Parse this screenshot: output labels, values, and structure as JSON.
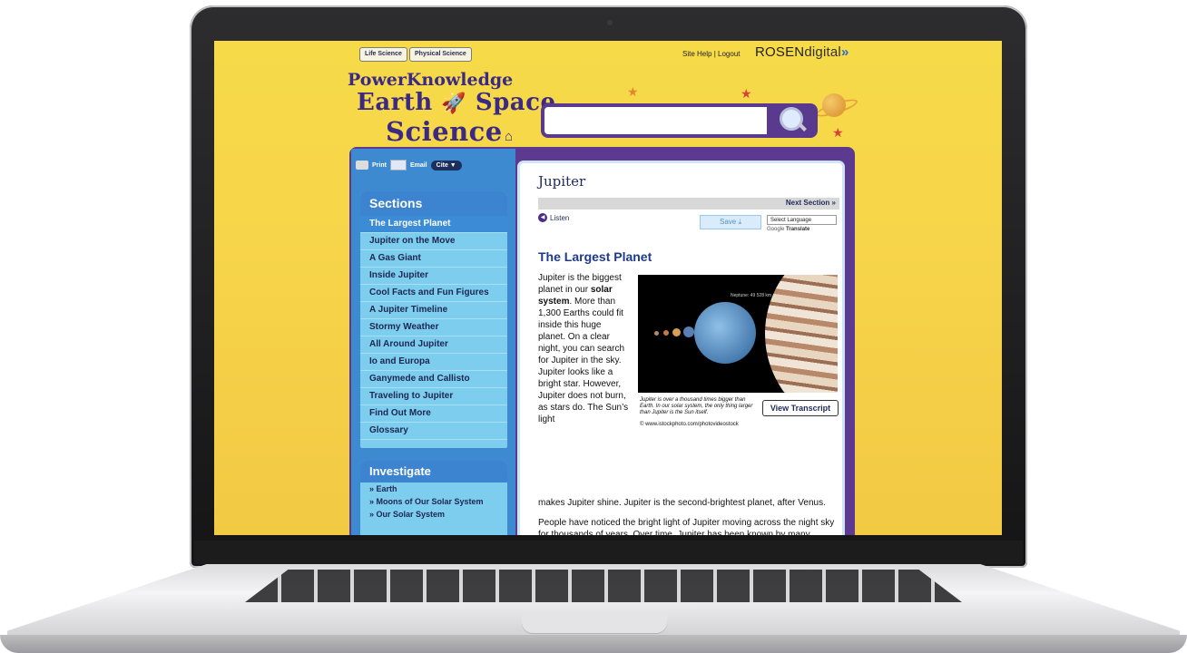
{
  "top_nav": {
    "life_science": "Life Science",
    "physical_science": "Physical Science",
    "site_help": "Site Help",
    "separator": "|",
    "logout": "Logout",
    "brand_rosen": "ROSEN",
    "brand_digital": "digital",
    "brand_chevrons": "»"
  },
  "logo": {
    "line1": "PowerKnowledge",
    "line2a": "Earth",
    "line2b": "Space",
    "line3": "Science"
  },
  "search": {
    "placeholder": ""
  },
  "toolbar": {
    "print": "Print",
    "email": "Email",
    "cite": "Cite ▼"
  },
  "sections": {
    "heading": "Sections",
    "items": [
      "The Largest Planet",
      "Jupiter on the Move",
      "A Gas Giant",
      "Inside Jupiter",
      "Cool Facts and Fun Figures",
      "A Jupiter Timeline",
      "Stormy Weather",
      "All Around Jupiter",
      "Io and Europa",
      "Ganymede and Callisto",
      "Traveling to Jupiter",
      "Find Out More",
      "Glossary"
    ]
  },
  "investigate": {
    "heading": "Investigate",
    "items": [
      "» Earth",
      "» Moons of Our Solar System",
      "» Our Solar System"
    ]
  },
  "article": {
    "title": "Jupiter",
    "next_section": "Next Section »",
    "listen": "Listen",
    "save": "Save",
    "save_icon": "download-icon",
    "select_language": "Select Language",
    "google": "Google",
    "translate": "Translate",
    "heading": "The Largest Planet",
    "para1_a": "Jupiter is the biggest planet in our ",
    "para1_bold": "solar system",
    "para1_b": ". More than 1,300 Earths could fit inside this huge planet. On a clear night, you can search for Jupiter in the sky. Jupiter looks like a bright star. However, Jupiter does not burn, as stars do. The Sun’s light",
    "para1_c": "makes Jupiter shine. Jupiter is the second-brightest planet, after Venus.",
    "para2": "People have noticed the bright light of Jupiter moving across the night sky for thousands of years. Over time, Jupiter has been known by many different names. Today, we call the planet Jupiter after Jupiter the king of the Roman gods.",
    "image_label": "Neptune: 49 528 km",
    "caption": "Jupiter is over a thousand times bigger than Earth. In our solar system, the only thing larger than Jupiter is the Sun itself.",
    "credit": "© www.istockphoto.com/photovideostock",
    "view_transcript": "View Transcript"
  }
}
